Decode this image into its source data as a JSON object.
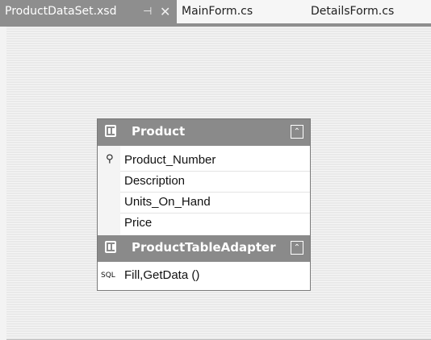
{
  "tabs": [
    {
      "label": "ProductDataSet.xsd",
      "pin": "⊣",
      "close": "✕",
      "active": true
    },
    {
      "label": "MainForm.cs",
      "active": false
    },
    {
      "label": "DetailsForm.cs",
      "active": false
    }
  ],
  "table": {
    "title": "Product",
    "icon": "datatable-icon",
    "collapse": "⌃",
    "columns": [
      "Product_Number",
      "Description",
      "Units_On_Hand",
      "Price"
    ],
    "key_icon": "⚲"
  },
  "adapter": {
    "title": "ProductTableAdapter",
    "icon": "tableadapter-icon",
    "collapse": "⌃",
    "query_icon": "SQL",
    "query": "Fill,GetData ()"
  }
}
